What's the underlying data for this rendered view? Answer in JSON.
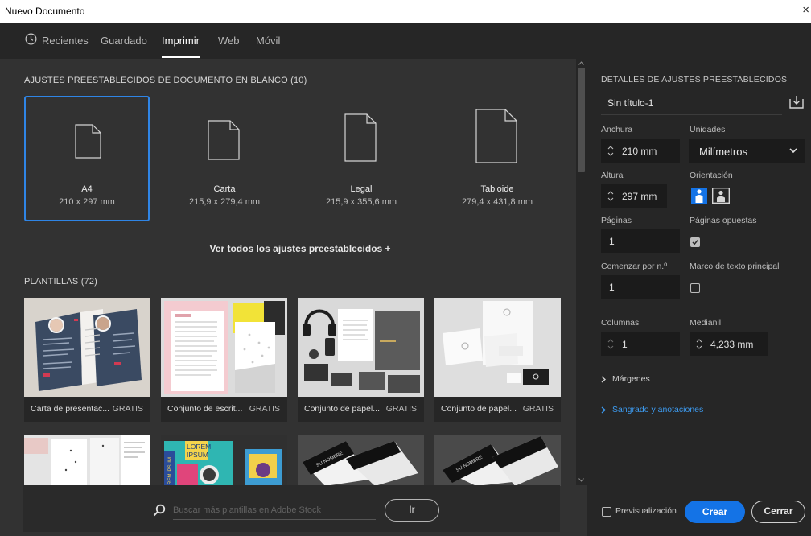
{
  "window": {
    "title": "Nuevo Documento",
    "close": "×"
  },
  "tabs": [
    {
      "label": "Recientes"
    },
    {
      "label": "Guardado"
    },
    {
      "label": "Imprimir"
    },
    {
      "label": "Web"
    },
    {
      "label": "Móvil"
    }
  ],
  "blank_presets": {
    "title": "AJUSTES PREESTABLECIDOS DE DOCUMENTO EN BLANCO",
    "count": "(10)",
    "items": [
      {
        "name": "A4",
        "size": "210 x 297 mm"
      },
      {
        "name": "Carta",
        "size": "215,9 x 279,4 mm"
      },
      {
        "name": "Legal",
        "size": "215,9 x 355,6 mm"
      },
      {
        "name": "Tabloide",
        "size": "279,4 x 431,8 mm"
      }
    ],
    "see_all": "Ver todos los ajustes preestablecidos +"
  },
  "templates": {
    "title": "PLANTILLAS",
    "count": "(72)",
    "items": [
      {
        "title": "Carta de presentac...",
        "badge": "GRATIS"
      },
      {
        "title": "Conjunto de escrit...",
        "badge": "GRATIS"
      },
      {
        "title": "Conjunto de papel...",
        "badge": "GRATIS"
      },
      {
        "title": "Conjunto de papel...",
        "badge": "GRATIS"
      }
    ],
    "row2_texts": {
      "lorem": "LOREM",
      "ipsum": "IPSUM",
      "side": "REM IPSUM",
      "name": "SU NOMBRE"
    }
  },
  "search": {
    "placeholder": "Buscar más plantillas en Adobe Stock",
    "go_label": "Ir"
  },
  "details": {
    "heading": "DETALLES DE AJUSTES PREESTABLECIDOS",
    "preset_name": "Sin título-1",
    "width_label": "Anchura",
    "width_value": "210 mm",
    "units_label": "Unidades",
    "units_value": "Milímetros",
    "height_label": "Altura",
    "height_value": "297 mm",
    "orientation_label": "Orientación",
    "pages_label": "Páginas",
    "pages_value": "1",
    "facing_label": "Páginas opuestas",
    "facing_checked": true,
    "start_label": "Comenzar por n.º",
    "start_value": "1",
    "primary_frame_label": "Marco de texto principal",
    "primary_frame_checked": false,
    "columns_label": "Columnas",
    "columns_value": "1",
    "gutter_label": "Medianil",
    "gutter_value": "4,233 mm",
    "margins_label": "Márgenes",
    "bleed_label": "Sangrado y anotaciones",
    "preview_label": "Previsualización",
    "create_label": "Crear",
    "close_label": "Cerrar"
  },
  "colors": {
    "accent": "#1473e6",
    "selection": "#2f85e6",
    "link": "#3d9bf0",
    "panel_bg": "#262626",
    "main_bg": "#323232"
  }
}
